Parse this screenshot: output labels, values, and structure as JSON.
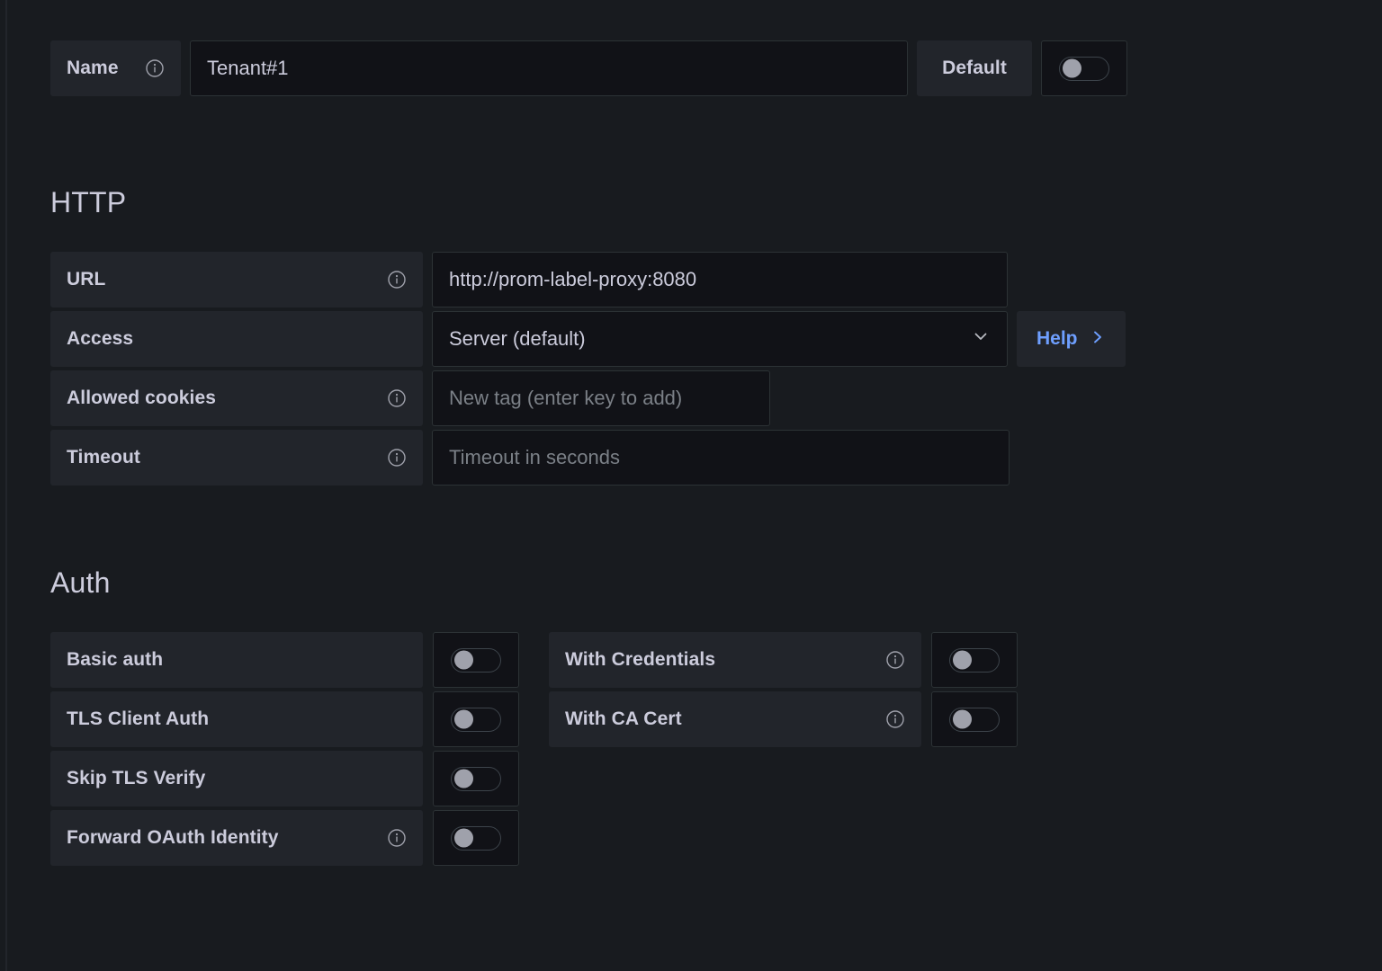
{
  "colors": {
    "background": "#181b1f",
    "panel": "#22252b",
    "field": "#111217",
    "border": "#2c3235",
    "text": "#ccccdc",
    "placeholder": "#7b8087",
    "link": "#6e9fff",
    "knob": "#9fa1ab"
  },
  "name_row": {
    "label": "Name",
    "info_icon": "info-circle-icon",
    "value": "Tenant#1",
    "default_label": "Default",
    "default_toggle": {
      "state": "off",
      "icon": "toggle-switch-icon"
    }
  },
  "http": {
    "title": "HTTP",
    "rows": [
      {
        "label": "URL",
        "has_info": true,
        "info_icon": "info-circle-icon",
        "value": "http://prom-label-proxy:8080",
        "is_placeholder": false,
        "control": "text"
      },
      {
        "label": "Access",
        "has_info": false,
        "value": "Server (default)",
        "is_placeholder": false,
        "control": "select",
        "chevron_icon": "chevron-down-icon"
      },
      {
        "label": "Allowed cookies",
        "has_info": true,
        "info_icon": "info-circle-icon",
        "value": "New tag (enter key to add)",
        "is_placeholder": true,
        "control": "text"
      },
      {
        "label": "Timeout",
        "has_info": true,
        "info_icon": "info-circle-icon",
        "value": "Timeout in seconds",
        "is_placeholder": true,
        "control": "text"
      }
    ],
    "help_button": {
      "label": "Help",
      "icon": "chevron-right-icon"
    }
  },
  "auth": {
    "title": "Auth",
    "rows": [
      {
        "left": {
          "label": "Basic auth",
          "has_info": false,
          "toggle": {
            "state": "off",
            "icon": "toggle-switch-icon"
          }
        },
        "right": {
          "label": "With Credentials",
          "has_info": true,
          "info_icon": "info-circle-icon",
          "toggle": {
            "state": "off",
            "icon": "toggle-switch-icon"
          }
        }
      },
      {
        "left": {
          "label": "TLS Client Auth",
          "has_info": false,
          "toggle": {
            "state": "off",
            "icon": "toggle-switch-icon"
          }
        },
        "right": {
          "label": "With CA Cert",
          "has_info": true,
          "info_icon": "info-circle-icon",
          "toggle": {
            "state": "off",
            "icon": "toggle-switch-icon"
          }
        }
      },
      {
        "left": {
          "label": "Skip TLS Verify",
          "has_info": false,
          "toggle": {
            "state": "off",
            "icon": "toggle-switch-icon"
          }
        },
        "right": null
      },
      {
        "left": {
          "label": "Forward OAuth Identity",
          "has_info": true,
          "info_icon": "info-circle-icon",
          "toggle": {
            "state": "off",
            "icon": "toggle-switch-icon"
          }
        },
        "right": null
      }
    ]
  }
}
